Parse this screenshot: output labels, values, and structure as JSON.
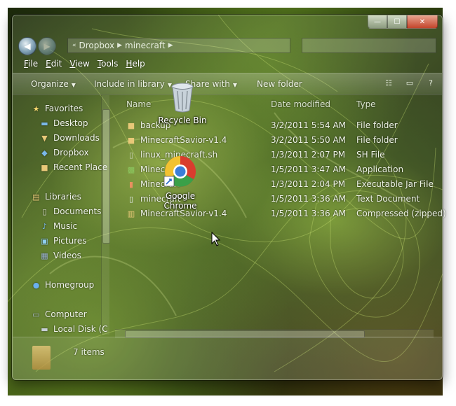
{
  "window": {
    "breadcrumb": [
      "Dropbox",
      "minecraft"
    ],
    "caption_buttons": {
      "minimize": "—",
      "maximize": "☐",
      "close": "✕"
    }
  },
  "menu": [
    {
      "label_underline": "F",
      "label_rest": "ile"
    },
    {
      "label_underline": "E",
      "label_rest": "dit"
    },
    {
      "label_underline": "V",
      "label_rest": "iew"
    },
    {
      "label_underline": "T",
      "label_rest": "ools"
    },
    {
      "label_underline": "H",
      "label_rest": "elp"
    }
  ],
  "toolbar": {
    "organize": "Organize",
    "include_in_library": "Include in library",
    "share_with": "Share with",
    "new_folder": "New folder"
  },
  "nav": {
    "favorites": "Favorites",
    "desktop": "Desktop",
    "downloads": "Downloads",
    "dropbox": "Dropbox",
    "recent_places": "Recent Place",
    "libraries": "Libraries",
    "documents": "Documents",
    "music": "Music",
    "pictures": "Pictures",
    "videos": "Videos",
    "homegroup": "Homegroup",
    "computer": "Computer",
    "local_disk": "Local Disk (C"
  },
  "columns": {
    "name": "Name",
    "date_modified": "Date modified",
    "type": "Type"
  },
  "files": [
    {
      "name": "backup",
      "date": "3/2/2011 5:54 AM",
      "type": "File folder",
      "icon": "folder-icon"
    },
    {
      "name": "MinecraftSavior-v1.4",
      "date": "3/2/2011 5:50 AM",
      "type": "File folder",
      "icon": "folder-icon"
    },
    {
      "name": "linux_minecraft.sh",
      "date": "1/3/2011 2:07 PM",
      "type": "SH File",
      "icon": "script-icon"
    },
    {
      "name": "Minecraft",
      "date": "1/5/2011 3:47 AM",
      "type": "Application",
      "icon": "minecraft-icon"
    },
    {
      "name": "Minecraft",
      "date": "1/3/2011 2:04 PM",
      "type": "Executable Jar File",
      "icon": "jar-icon"
    },
    {
      "name": "minecraft",
      "date": "1/5/2011 3:36 AM",
      "type": "Text Document",
      "icon": "text-file-icon"
    },
    {
      "name": "MinecraftSavior-v1.4",
      "date": "1/5/2011 3:36 AM",
      "type": "Compressed (zipped)",
      "icon": "zip-icon"
    }
  ],
  "status": {
    "item_count": "7 items"
  },
  "desktop": {
    "recycle_bin": "Recycle Bin",
    "chrome_line1": "Google",
    "chrome_line2": "Chrome"
  }
}
